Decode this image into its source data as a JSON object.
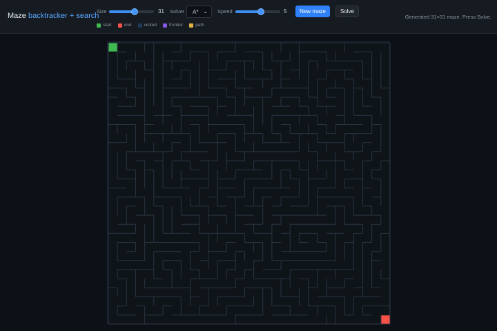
{
  "header": {
    "title": "Maze",
    "subtitle": "backtracker + search"
  },
  "controls": {
    "size_label": "Size",
    "size_value": "31",
    "size_min": 5,
    "size_max": 51,
    "solver_label": "Solver",
    "solver_value": "A*",
    "speed_label": "Speed",
    "speed_value": "5",
    "speed_min": 1,
    "speed_max": 8,
    "new_maze_label": "New maze",
    "solve_label": "Solve"
  },
  "status": "Generated 31×31 maze. Press Solve.",
  "legend": [
    {
      "label": "start",
      "color": "#3fb950"
    },
    {
      "label": "end",
      "color": "#f85149"
    },
    {
      "label": "visited",
      "color": "#1f3a5a"
    },
    {
      "label": "frontier",
      "color": "#8957e5"
    },
    {
      "label": "path",
      "color": "#e3b341"
    }
  ],
  "maze": {
    "cells": 31,
    "wall_color": "#2a3442",
    "background": "#0f1419",
    "start_color": "#3fb950",
    "end_color": "#f85149"
  }
}
